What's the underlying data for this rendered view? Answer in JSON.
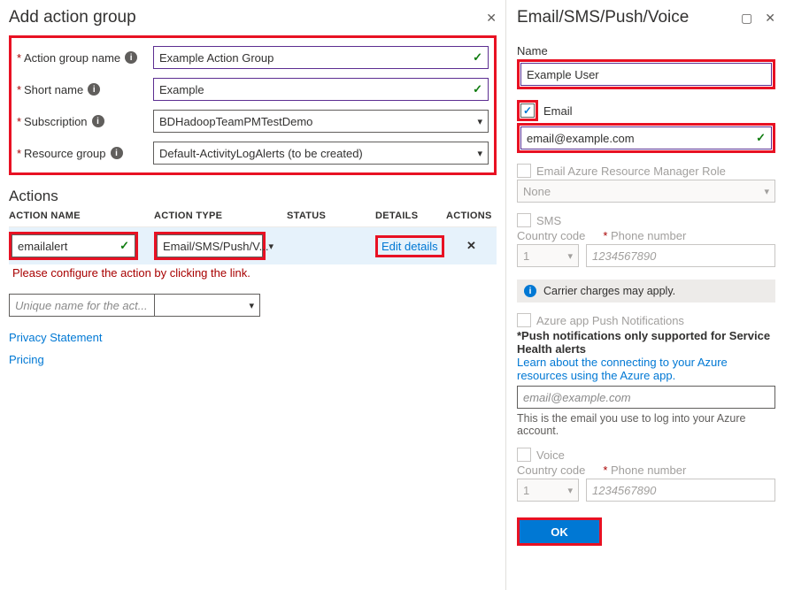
{
  "left": {
    "title": "Add action group",
    "form": {
      "group_name": {
        "label": "Action group name",
        "value": "Example Action Group"
      },
      "short_name": {
        "label": "Short name",
        "value": "Example"
      },
      "subscription": {
        "label": "Subscription",
        "value": "BDHadoopTeamPMTestDemo"
      },
      "resource_group": {
        "label": "Resource group",
        "value": "Default-ActivityLogAlerts (to be created)"
      }
    },
    "actions": {
      "heading": "Actions",
      "cols": {
        "name": "ACTION NAME",
        "type": "ACTION TYPE",
        "status": "STATUS",
        "details": "DETAILS",
        "actions": "ACTIONS"
      },
      "row1": {
        "name": "emailalert",
        "type": "Email/SMS/Push/V...",
        "edit": "Edit details"
      },
      "error": "Please configure the action by clicking the link.",
      "placeholder": "Unique name for the act..."
    },
    "links": {
      "privacy": "Privacy Statement",
      "pricing": "Pricing"
    }
  },
  "right": {
    "title": "Email/SMS/Push/Voice",
    "name": {
      "label": "Name",
      "value": "Example User"
    },
    "email": {
      "label": "Email",
      "value": "email@example.com"
    },
    "arm": {
      "label": "Email Azure Resource Manager Role",
      "value": "None"
    },
    "sms": {
      "label": "SMS",
      "cc_label": "Country code",
      "pn_label": "Phone number",
      "cc": "1",
      "pn": "1234567890",
      "note": "Carrier charges may apply."
    },
    "push": {
      "label": "Azure app Push Notifications",
      "bold": "*Push notifications only supported for Service Health alerts",
      "link": "Learn about the connecting to your Azure resources using the Azure app.",
      "placeholder": "email@example.com",
      "help": "This is the email you use to log into your Azure account."
    },
    "voice": {
      "label": "Voice",
      "cc_label": "Country code",
      "pn_label": "Phone number",
      "cc": "1",
      "pn": "1234567890"
    },
    "ok": "OK"
  }
}
